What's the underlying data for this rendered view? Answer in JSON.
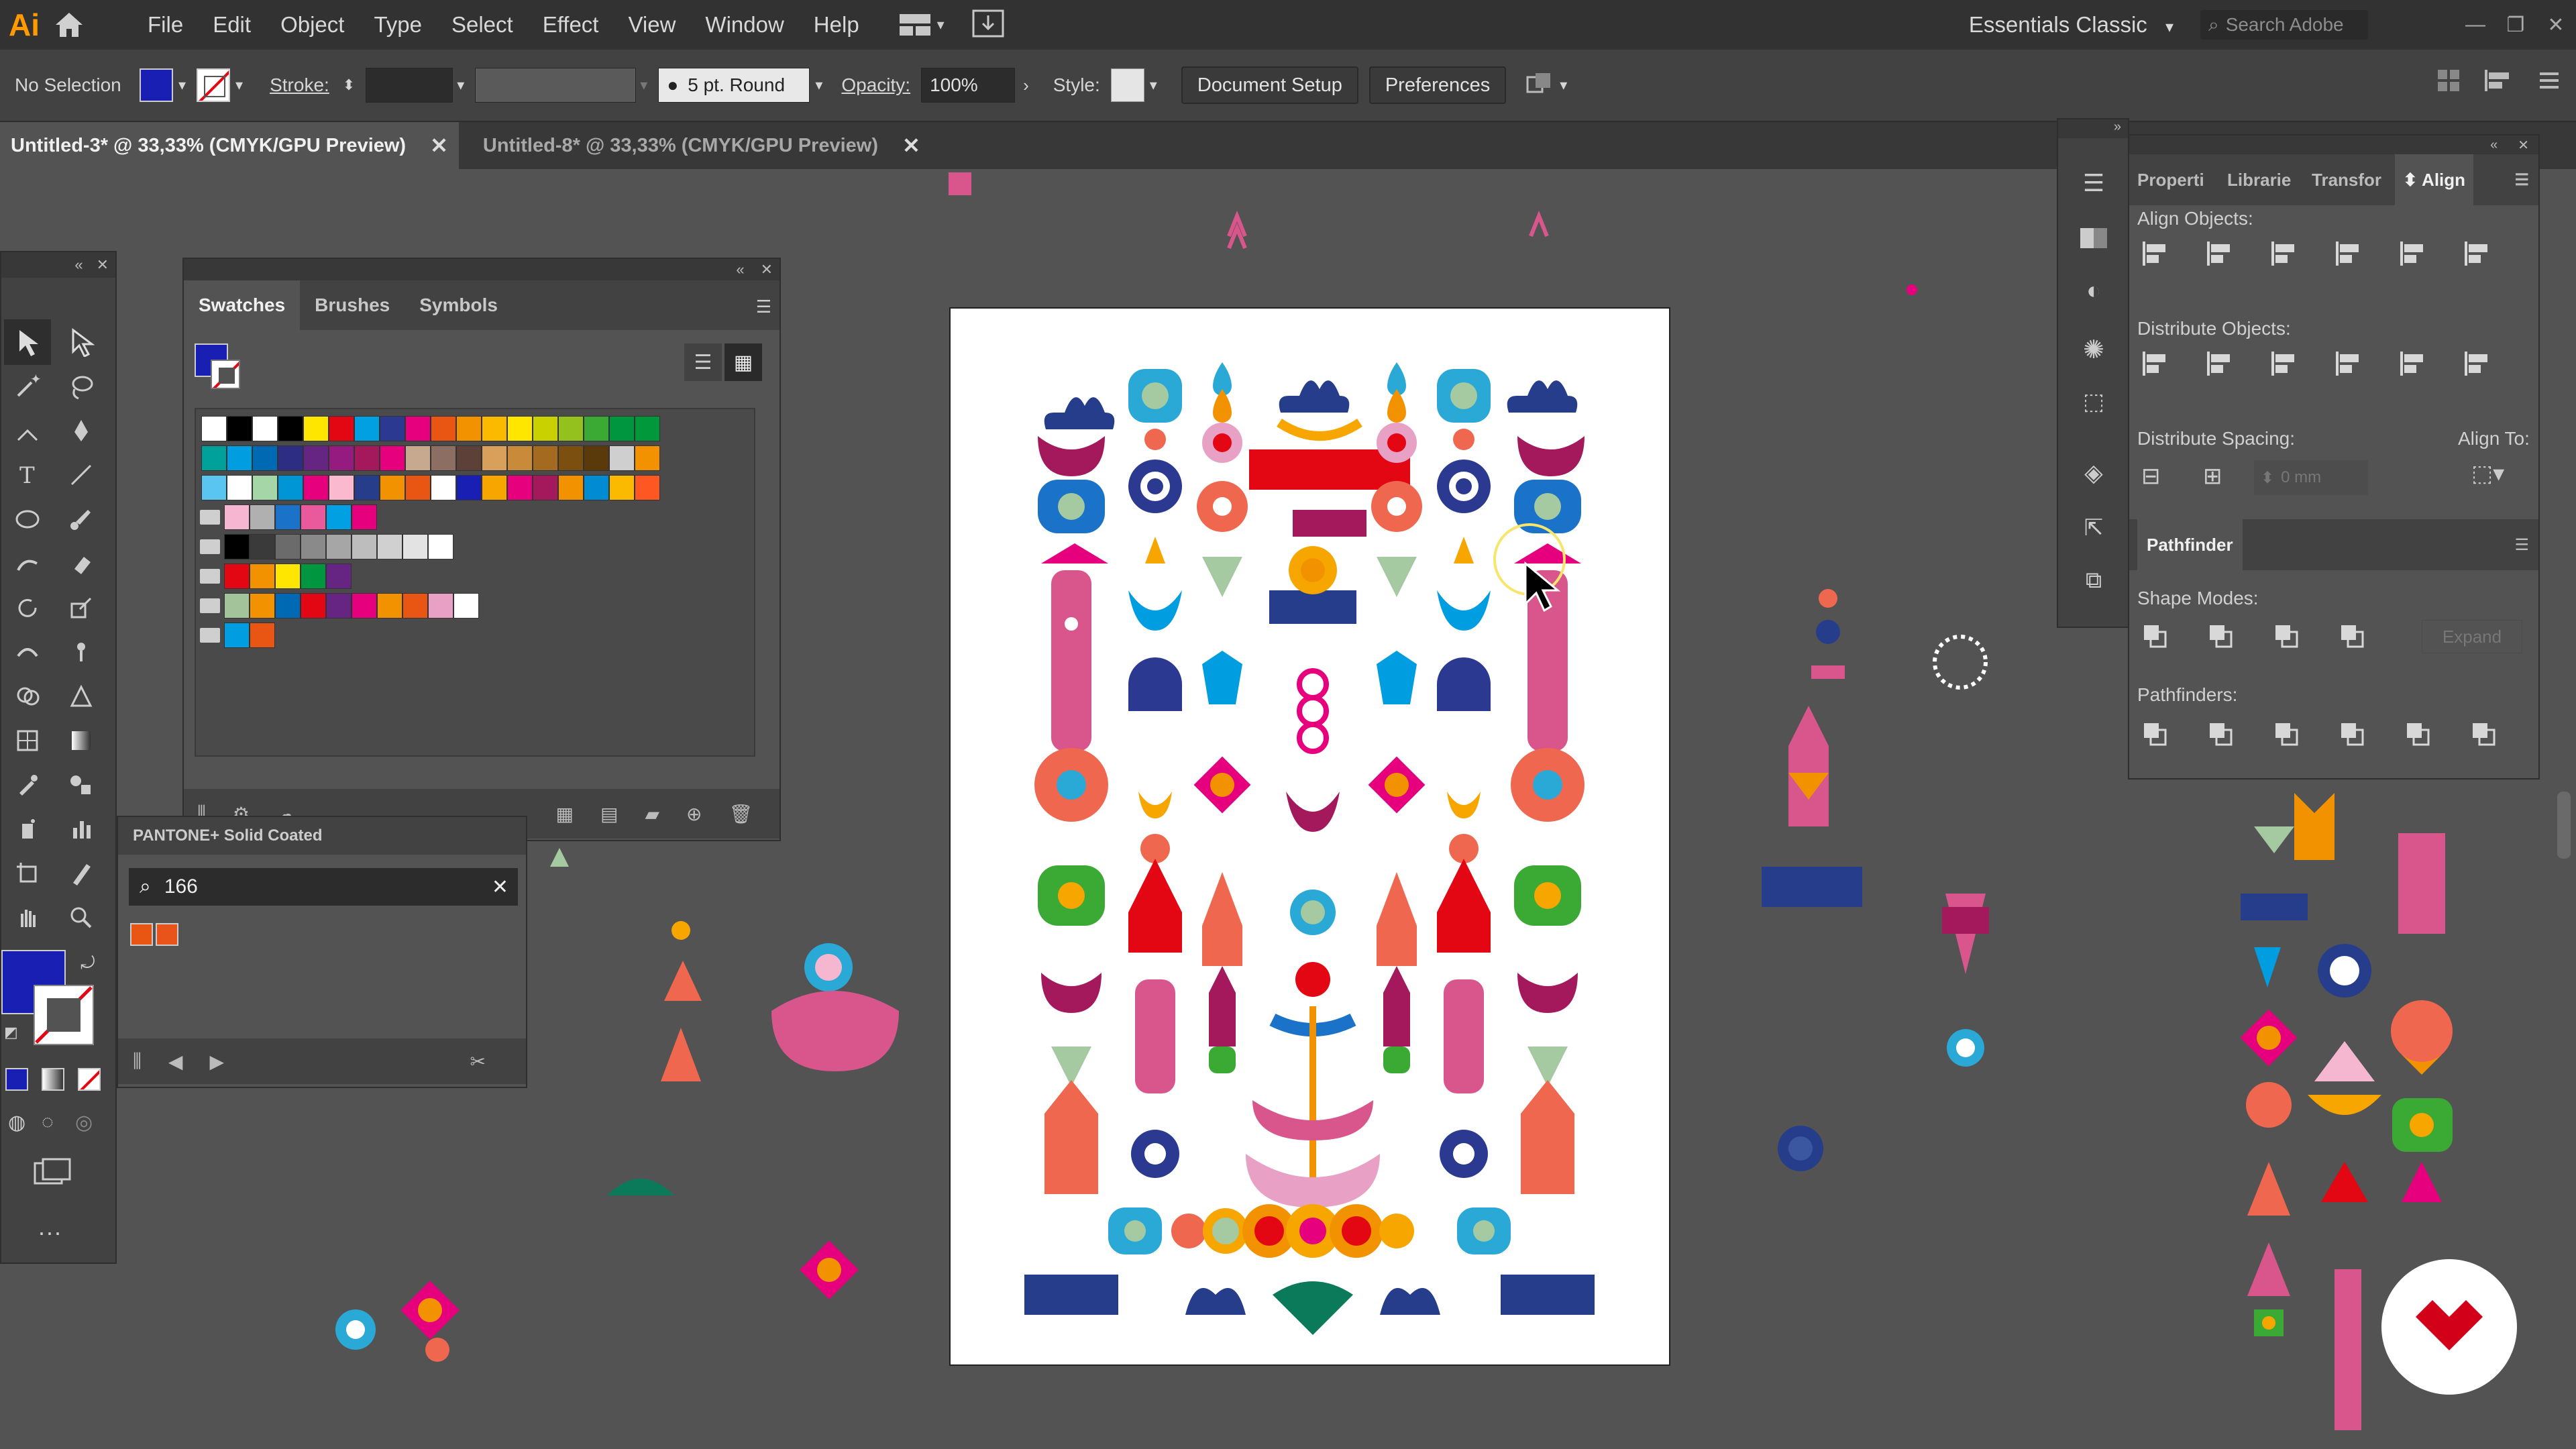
{
  "app": {
    "logo": "Ai",
    "home_icon": "home-icon"
  },
  "menu": [
    "File",
    "Edit",
    "Object",
    "Type",
    "Select",
    "Effect",
    "View",
    "Window",
    "Help"
  ],
  "workspace": "Essentials Classic",
  "search_placeholder": "Search Adobe",
  "control": {
    "selection": "No Selection",
    "fill_color": "#1a1fb4",
    "stroke_label": "Stroke:",
    "brush": "5 pt. Round",
    "opacity_label": "Opacity:",
    "opacity_value": "100%",
    "style_label": "Style:",
    "document_setup": "Document Setup",
    "preferences": "Preferences"
  },
  "tabs": [
    {
      "label": "Untitled-3* @ 33,33% (CMYK/GPU Preview)",
      "active": true
    },
    {
      "label": "Untitled-8* @ 33,33% (CMYK/GPU Preview)",
      "active": false
    }
  ],
  "swatches_panel": {
    "tabs": [
      "Swatches",
      "Brushes",
      "Symbols"
    ],
    "active_tab": "Swatches",
    "rows": [
      [
        "#ffffff",
        "#000000",
        "#ffffff",
        "#000000",
        "#ffe600",
        "#e30613",
        "#00a0e3",
        "#2b3990",
        "#e6007e",
        "#e95513",
        "#f39200",
        "#fbba00",
        "#ffe600",
        "#c9d200",
        "#95c11f",
        "#3aaa35",
        "#009640",
        "#00983a"
      ],
      [
        "#00a19a",
        "#009ee0",
        "#0069b4",
        "#2d2e83",
        "#662483",
        "#951b81",
        "#a3195b",
        "#e6007e",
        "#c6a98f",
        "#8d6e63",
        "#5d4037",
        "#d9a05b",
        "#c98a3a",
        "#a46a1f",
        "#7b4f10",
        "#5a3a0b",
        "#cfcfcf",
        "#f39200"
      ],
      [
        "#5bc5f2",
        "#ffffff",
        "#a5d6a7",
        "#0096d6",
        "#e6007e",
        "#fbb9cf",
        "#253d8b",
        "#f39200",
        "#e95513",
        "#ffffff",
        "#1a1fb4",
        "#f7a600",
        "#e6007e",
        "#a3195b",
        "#f39200",
        "#008bd2",
        "#fbba00",
        "#ff5722"
      ],
      [
        "#f6b5d1",
        "#b0b0b0",
        "#1a73c8",
        "#e85a9c",
        "#00a0e3",
        "#e6007e"
      ],
      [
        "#000000",
        "#3a3a3a",
        "#6b6b6b",
        "#8a8a8a",
        "#a6a6a6",
        "#bdbdbd",
        "#d0d0d0",
        "#e3e3e3",
        "#ffffff"
      ],
      [
        "#e30613",
        "#f39200",
        "#ffe600",
        "#009640",
        "#662483"
      ],
      [
        "#a3c49b",
        "#f39200",
        "#0069b4",
        "#e30613",
        "#662483",
        "#e6007e",
        "#f39200",
        "#e95513",
        "#e8a1c4",
        "#ffffff"
      ],
      [
        "#009ee0",
        "#e95513"
      ]
    ]
  },
  "pantone": {
    "title": "PANTONE+ Solid Coated",
    "search_value": "166",
    "swatches": [
      "#e95513",
      "#e9541a"
    ]
  },
  "align_panel": {
    "tabs": [
      "Properti",
      "Librarie",
      "Transfor",
      "Align"
    ],
    "active_tab": "Align",
    "align_objects": "Align Objects:",
    "distribute_objects": "Distribute Objects:",
    "distribute_spacing": "Distribute Spacing:",
    "align_to": "Align To:",
    "spacing_value": "0 mm"
  },
  "pathfinder": {
    "title": "Pathfinder",
    "shape_modes": "Shape Modes:",
    "expand": "Expand",
    "pathfinders": "Pathfinders:"
  },
  "colors": {
    "menubar": "#323232",
    "controlbar": "#424242",
    "canvas": "#535353",
    "accent_blue": "#1a1fb4",
    "pink": "#e6007e",
    "orange": "#f39200"
  }
}
